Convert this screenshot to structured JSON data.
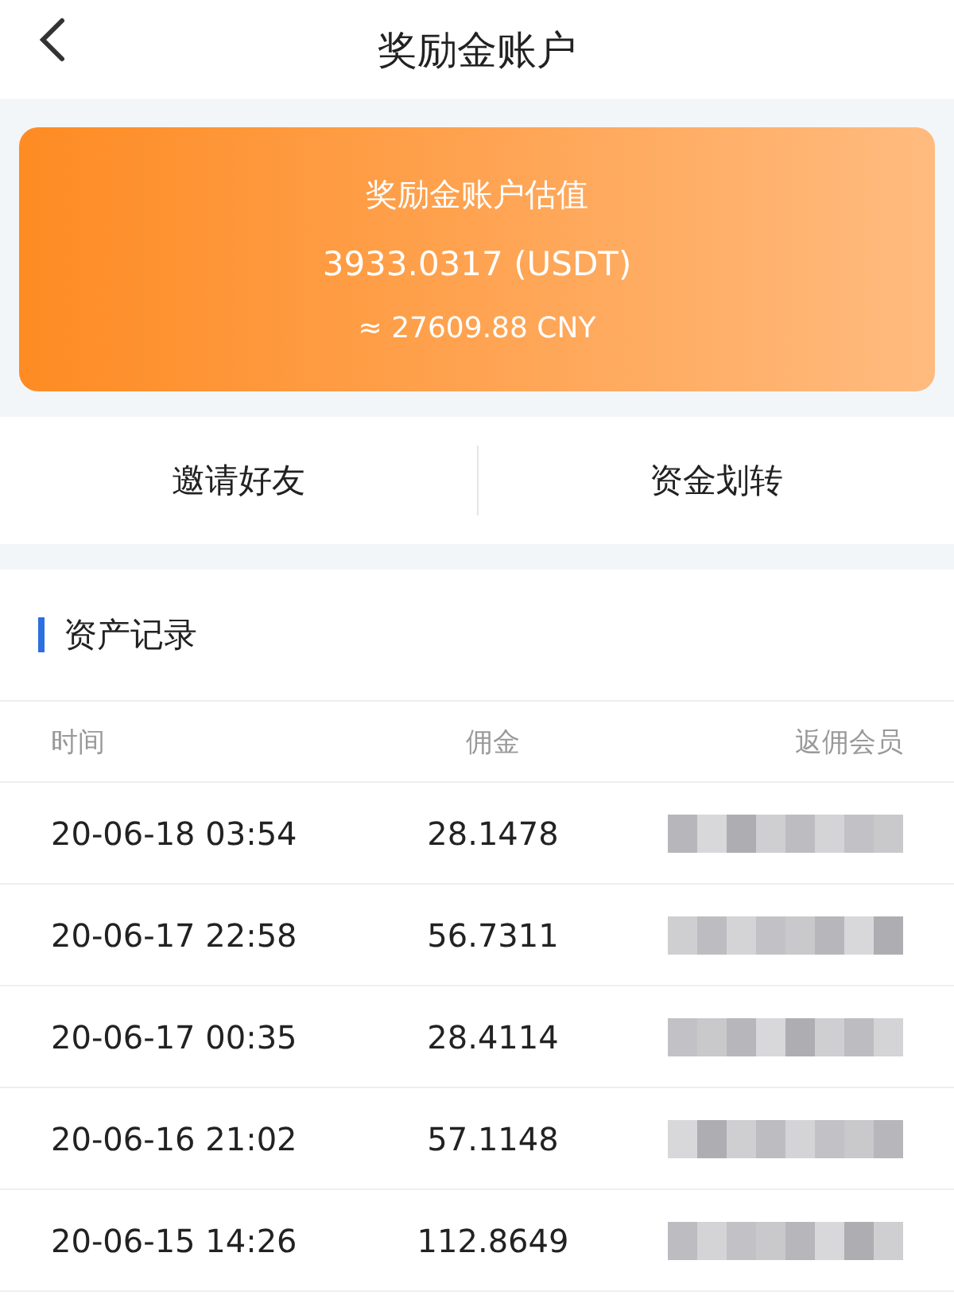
{
  "header": {
    "title": "奖励金账户"
  },
  "account_card": {
    "label": "奖励金账户估值",
    "value": "3933.0317 (USDT)",
    "converted": "≈ 27609.88 CNY"
  },
  "actions": [
    "邀请好友",
    "资金划转"
  ],
  "records": {
    "title": "资产记录",
    "columns": [
      "时间",
      "佣金",
      "返佣会员"
    ],
    "rows": [
      {
        "time": "20-06-18 03:54",
        "commission": "28.1478"
      },
      {
        "time": "20-06-17 22:58",
        "commission": "56.7311"
      },
      {
        "time": "20-06-17 00:35",
        "commission": "28.4114"
      },
      {
        "time": "20-06-16 21:02",
        "commission": "57.1148"
      },
      {
        "time": "20-06-15 14:26",
        "commission": "112.8649"
      }
    ]
  }
}
